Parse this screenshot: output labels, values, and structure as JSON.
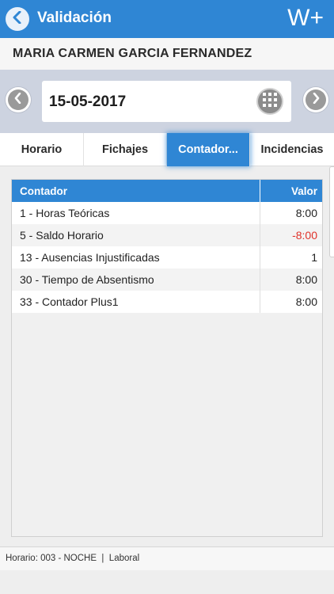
{
  "header": {
    "title": "Validación",
    "brand": "W+",
    "back_icon": "chevron-left-icon",
    "accent_color": "#2f86d4"
  },
  "employee": {
    "name": "MARIA CARMEN GARCIA FERNANDEZ"
  },
  "date_picker": {
    "date": "15-05-2017",
    "prev_icon": "chevron-left-icon",
    "next_icon": "chevron-right-icon",
    "calendar_icon": "grid-calendar-icon"
  },
  "tabs": [
    {
      "label": "Horario",
      "active": false
    },
    {
      "label": "Fichajes",
      "active": false
    },
    {
      "label": "Contador...",
      "active": true
    },
    {
      "label": "Incidencias",
      "active": false
    }
  ],
  "table": {
    "columns": [
      "Contador",
      "Valor"
    ],
    "rows": [
      {
        "contador": "1 - Horas Teóricas",
        "valor": "8:00",
        "negative": false
      },
      {
        "contador": "5 - Saldo Horario",
        "valor": "-8:00",
        "negative": true
      },
      {
        "contador": "13 - Ausencias Injustificadas",
        "valor": "1",
        "negative": false
      },
      {
        "contador": "30 - Tiempo de Absentismo",
        "valor": "8:00",
        "negative": false
      },
      {
        "contador": "33 - Contador Plus1",
        "valor": "8:00",
        "negative": false
      }
    ]
  },
  "footer": {
    "status": "Horario: 003 - NOCHE  |  Laboral"
  }
}
